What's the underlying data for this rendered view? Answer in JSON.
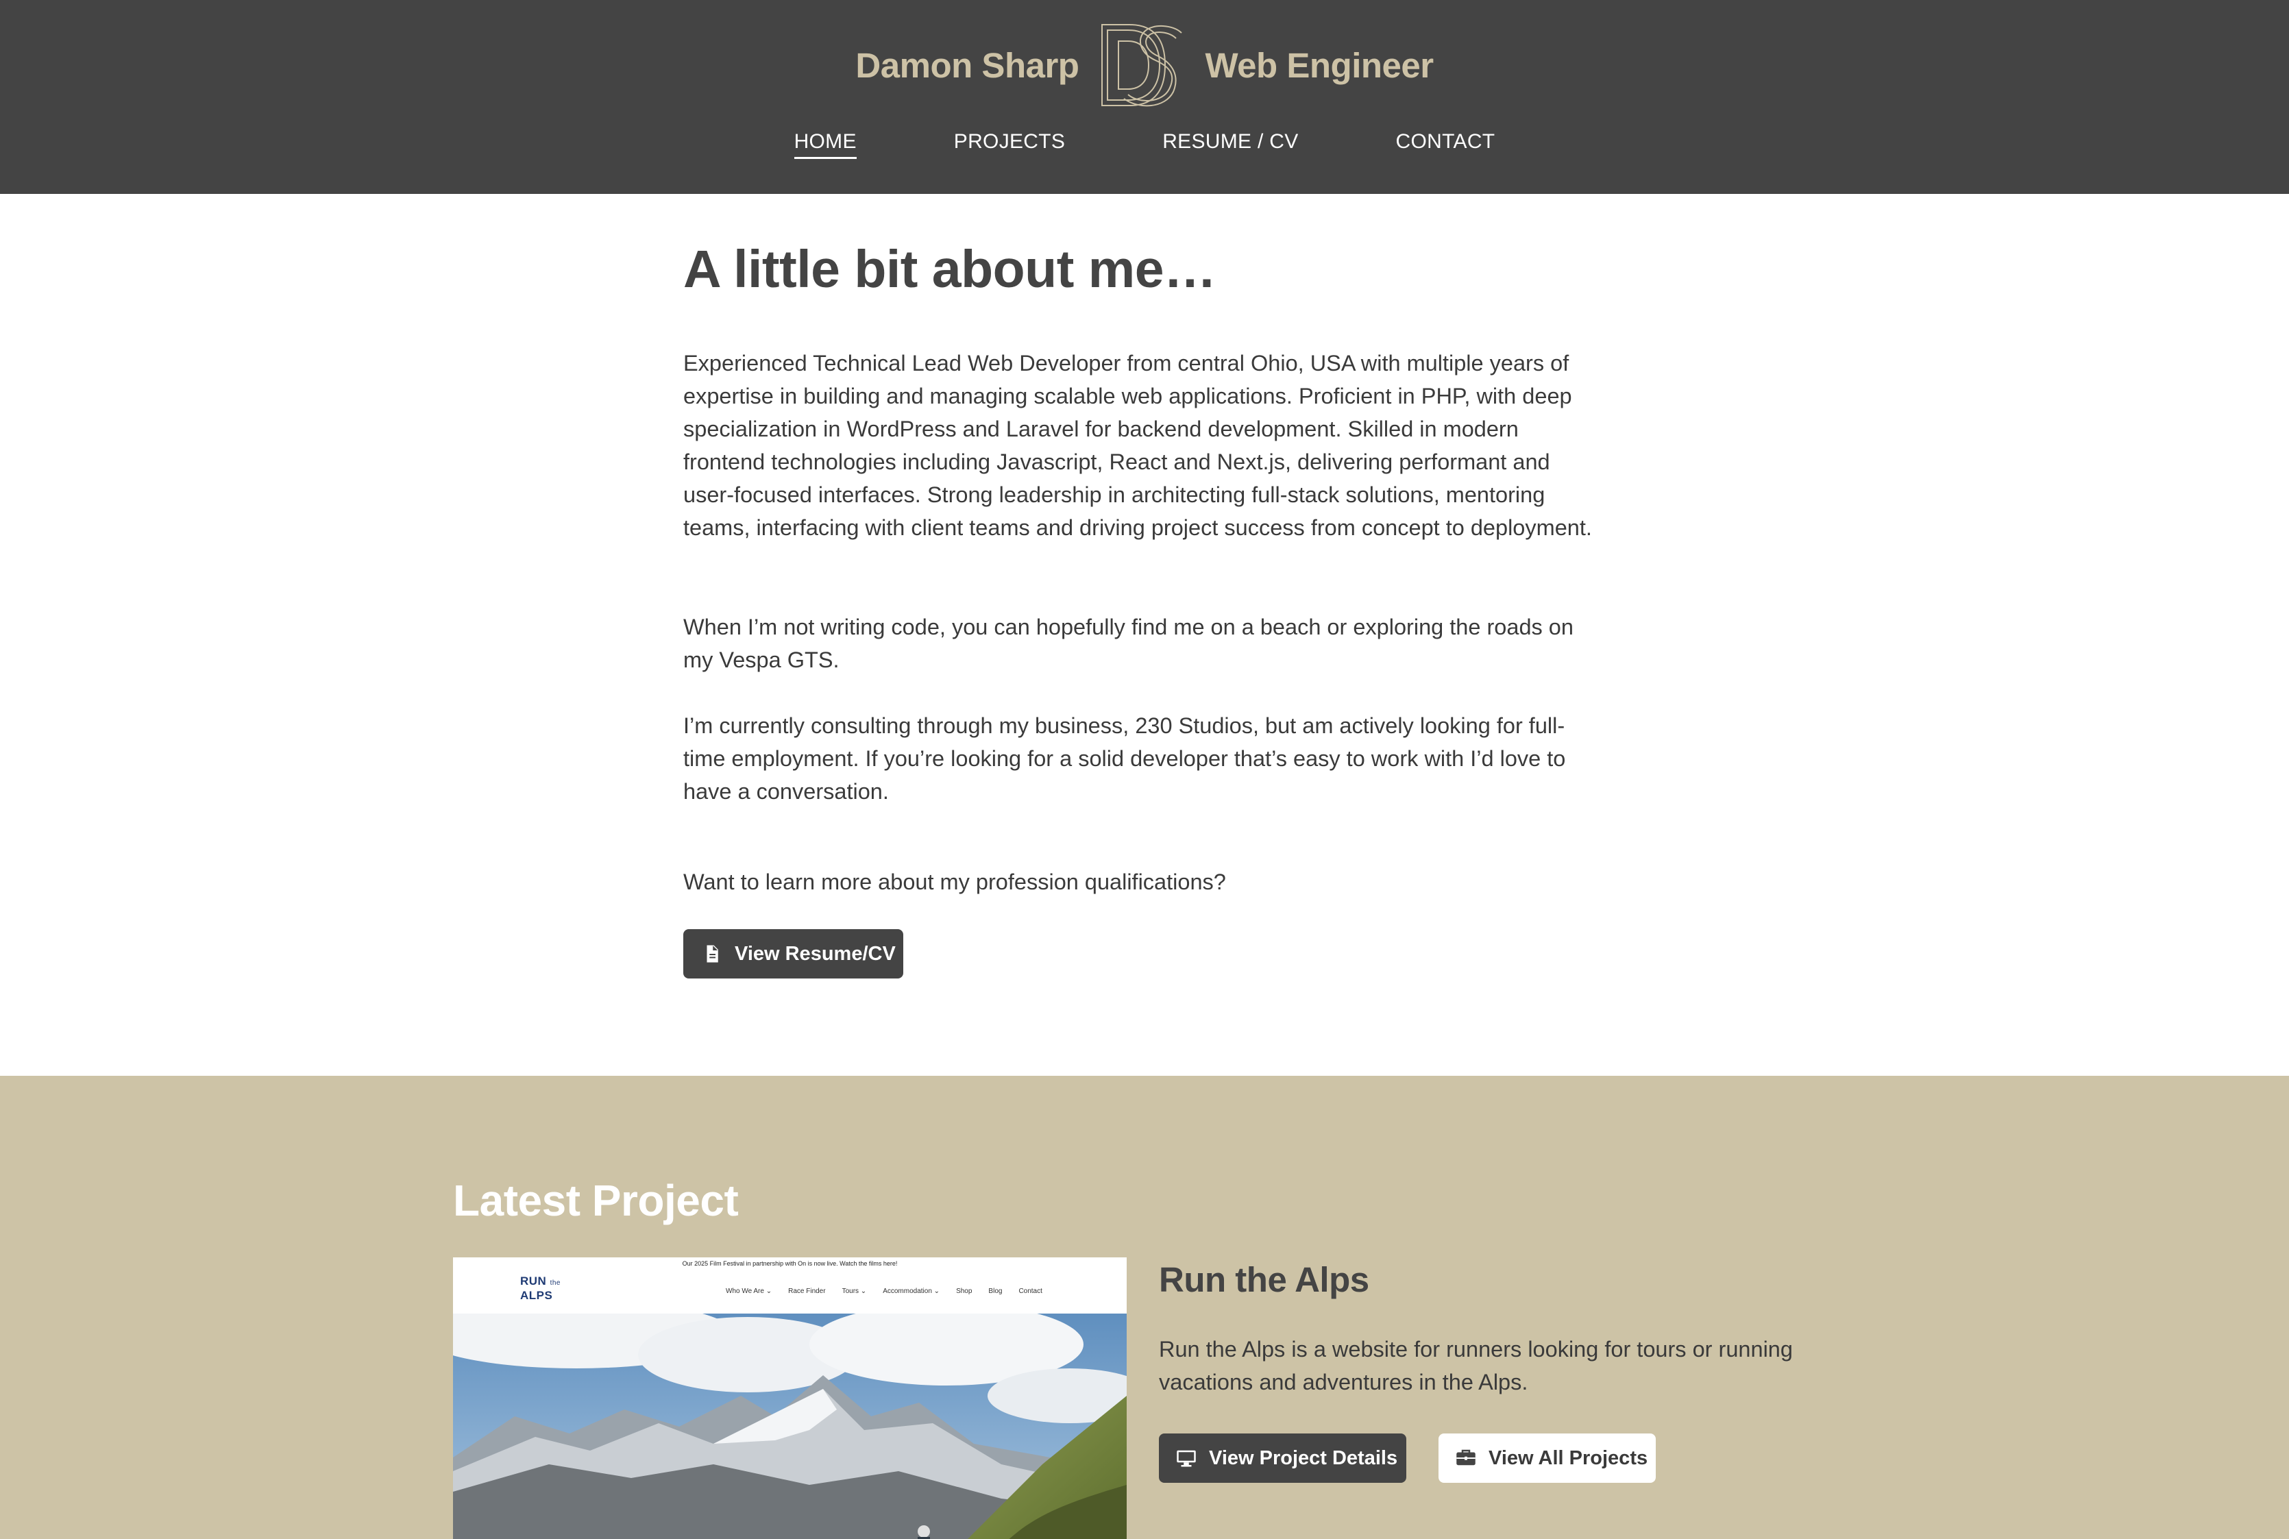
{
  "header": {
    "name": "Damon Sharp",
    "title": "Web Engineer",
    "logo_icon": "ds-monogram-logo",
    "nav": [
      {
        "label": "HOME",
        "active": true
      },
      {
        "label": "PROJECTS",
        "active": false
      },
      {
        "label": "RESUME / CV",
        "active": false
      },
      {
        "label": "CONTACT",
        "active": false
      }
    ]
  },
  "about": {
    "heading": "A little bit about me…",
    "paragraphs": [
      "Experienced Technical Lead Web Developer from central Ohio, USA with multiple years of expertise in building and managing scalable web applications. Proficient in PHP, with deep specialization in WordPress and Laravel for backend development. Skilled in modern frontend technologies including Javascript, React and Next.js, delivering performant and user-focused interfaces. Strong leadership in architecting full-stack solutions, mentoring teams, interfacing with client teams and driving project success from concept to deployment.",
      "When I’m not writing code, you can hopefully find me on a beach or exploring the roads on my Vespa GTS.",
      "I’m currently consulting through my business, 230 Studios, but am actively looking for full-time employment. If you’re looking for a solid developer that’s easy to work with I’d love to have a conversation."
    ],
    "cta_text": "Want to learn more about my profession qualifications?",
    "resume_button": "View Resume/CV",
    "resume_icon": "document-icon"
  },
  "latest": {
    "heading": "Latest Project",
    "project_title": "Run the Alps",
    "project_desc": "Run the Alps is a website for runners looking for tours or running vacations and adventures in the Alps.",
    "details_button": "View Project Details",
    "details_icon": "monitor-icon",
    "all_button": "View All Projects",
    "all_icon": "briefcase-icon",
    "screenshot": {
      "banner": "Our 2025 Film Festival in partnership with On is now live. Watch the films here!",
      "logo_line1": "RUN",
      "logo_line2": "the",
      "logo_line3": "ALPS",
      "nav": [
        "Who We Are ⌄",
        "Race Finder",
        "Tours ⌄",
        "Accommodation ⌄",
        "Shop",
        "Blog",
        "Contact"
      ]
    }
  },
  "colors": {
    "header_bg": "#444444",
    "brand_accent": "#cdc2a6",
    "section_bg": "#cdc3a6",
    "dark_button": "#444444"
  }
}
